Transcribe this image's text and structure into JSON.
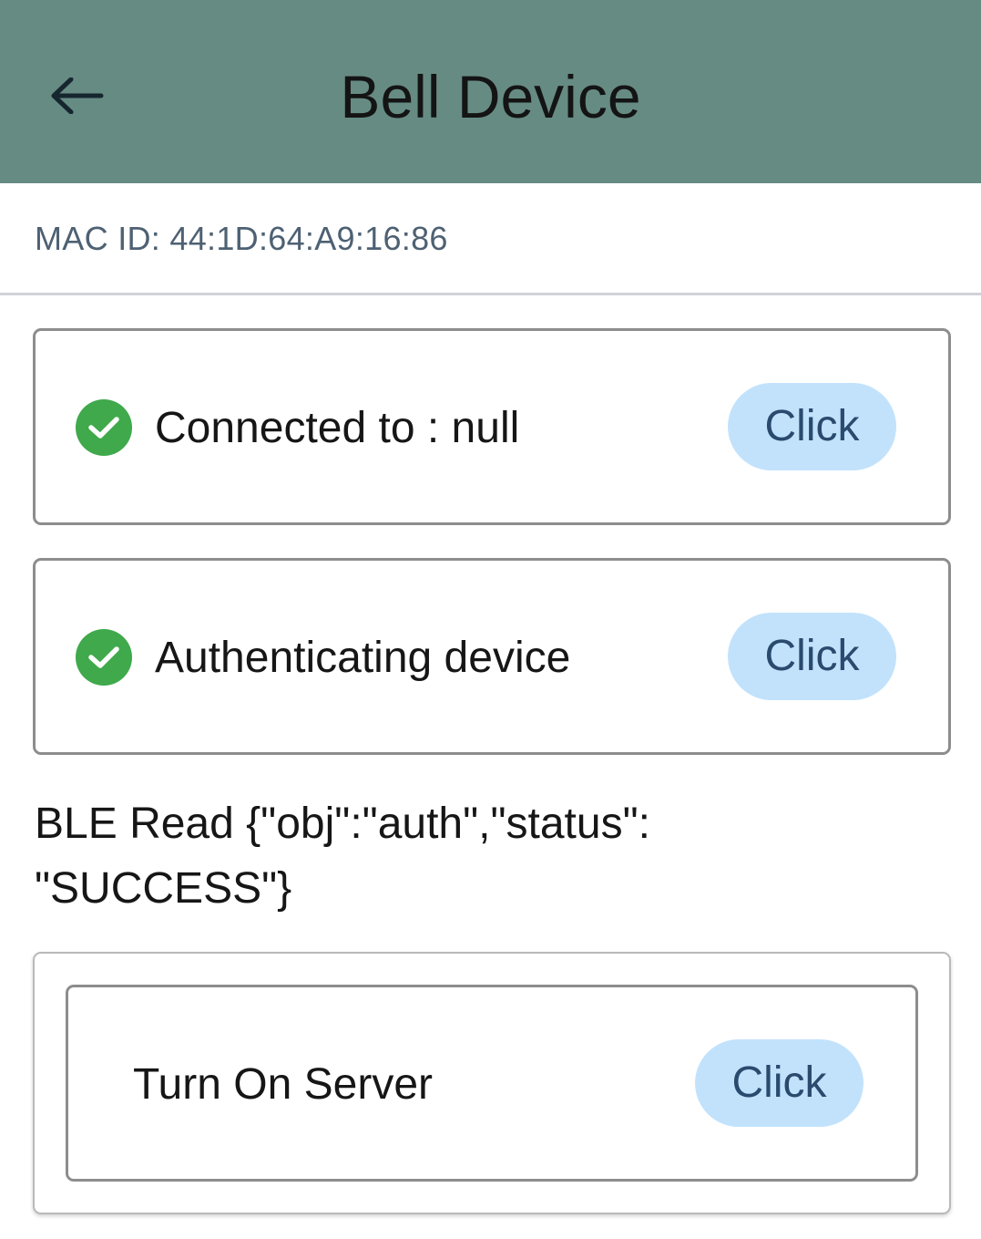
{
  "header": {
    "title": "Bell Device",
    "back_icon": "arrow-left-icon",
    "background_color": "#668b83"
  },
  "device": {
    "mac_label": "MAC ID: 44:1D:64:A9:16:86"
  },
  "steps": [
    {
      "status_icon": "check-circle-icon",
      "label": "Connected to : null",
      "button_label": "Click"
    },
    {
      "status_icon": "check-circle-icon",
      "label": "Authenticating device",
      "button_label": "Click"
    }
  ],
  "ble_read": {
    "line1": "BLE Read {\"obj\":\"auth\",\"status\":",
    "line2": "\"SUCCESS\"}"
  },
  "server": {
    "label": "Turn On Server",
    "button_label": "Click"
  },
  "colors": {
    "success": "#3fa94b",
    "button_bg": "#c2e2fc",
    "button_text": "#2a4a6e"
  }
}
